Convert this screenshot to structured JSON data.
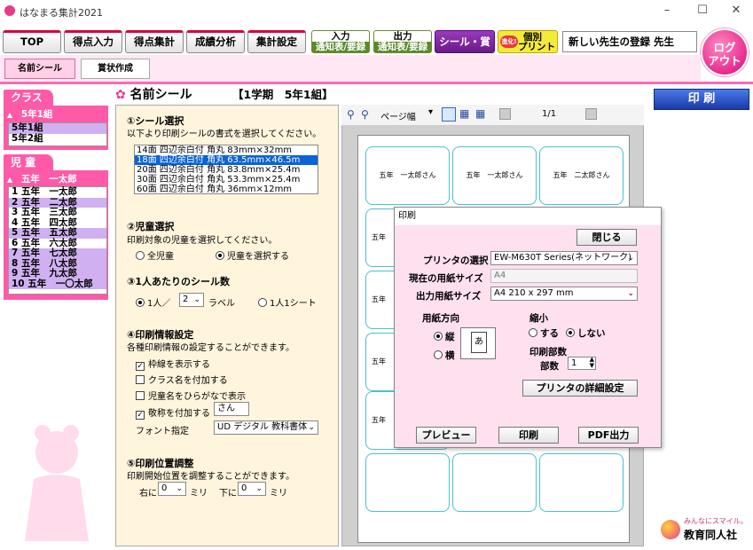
{
  "window": {
    "title": "はなまる集計2021"
  },
  "menu": {
    "top": "TOP",
    "score_input": "得点入力",
    "score_total": "得点集計",
    "analysis": "成績分析",
    "settings": "集計設定",
    "input_top": "入力",
    "input_bottom": "通知表/要録",
    "output_top": "出力",
    "output_bottom": "通知表/要録",
    "seal": "シール・賞状",
    "print_badge": "進化!",
    "print_top": "個別",
    "print_bottom": "プリント",
    "teacher": "新しい先生の登録 先生",
    "logout_1": "ログ",
    "logout_2": "アウト"
  },
  "subtabs": {
    "name_seal": "名前シール",
    "certificate": "賞状作成"
  },
  "class_panel": {
    "header": "クラス",
    "selected": "5年1組",
    "items": [
      "5年1組",
      "5年2組"
    ]
  },
  "student_panel": {
    "header": "児 童",
    "selected": "五年　一太郎",
    "items": [
      "1 五年　一太郎",
      "2 五年　二太郎",
      "3 五年　三太郎",
      "4 五年　四太郎",
      "5 五年　五太郎",
      "6 五年　六太郎",
      "7 五年　七太郎",
      "8 五年　八太郎",
      "9 五年　九太郎",
      "10 五年　一〇太郎"
    ]
  },
  "page": {
    "title": "名前シール",
    "term": "【1学期　5年1組】"
  },
  "seal_select": {
    "heading": "①シール選択",
    "desc": "以下より印刷シールの書式を選択してください。",
    "formats": [
      "14面 四辺余白付 角丸 83mm×32mm",
      "18面 四辺余白付 角丸 63.5mm×46.5m",
      "20面 四辺余白付 角丸 83.8mm×25.4m",
      "30面 四辺余白付 角丸 53.3mm×25.4m",
      "60面 四辺余白付 角丸 36mm×12mm"
    ]
  },
  "student_select": {
    "heading": "②児童選択",
    "desc": "印刷対象の児童を選択してください。",
    "all": "全児童",
    "choose": "児童を選択する"
  },
  "per_person": {
    "heading": "③1人あたりのシール数",
    "one_per": "1人／",
    "count": "2",
    "label": "ラベル",
    "one_sheet": "1人1シート"
  },
  "print_info": {
    "heading": "④印刷情報設定",
    "desc": "各種印刷情報の設定することができます。",
    "border": "枠線を表示する",
    "class_name": "クラス名を付加する",
    "hiragana": "児童名をひらがなで表示",
    "honorific": "敬称を付加する",
    "honorific_value": "さん",
    "font_label": "フォント指定",
    "font_value": "UD デジタル 教科書体"
  },
  "position": {
    "heading": "⑤印刷位置調整",
    "desc": "印刷開始位置を調整することができます。",
    "right": "右に",
    "right_val": "0",
    "down": "下に",
    "down_val": "0",
    "unit": "ミリ"
  },
  "preview": {
    "zoom": "ページ幅",
    "pages": "1/1",
    "labels": [
      "五年　一太郎さん",
      "五年　一太郎さん",
      "五年　二太郎さん"
    ],
    "side_label": "五年"
  },
  "print_button": "印 刷",
  "dialog": {
    "title": "印刷",
    "close": "閉じる",
    "printer_label": "プリンタの選択",
    "printer_value": "EW-M630T Series(ネットワーク)",
    "current_paper_label": "現在の用紙サイズ",
    "current_paper_value": "A4",
    "output_paper_label": "出力用紙サイズ",
    "output_paper_value": "A4 210 x 297 mm",
    "orientation": "用紙方向",
    "portrait": "縦",
    "landscape": "横",
    "glyph": "あ",
    "shrink": "縮小",
    "shrink_yes": "する",
    "shrink_no": "しない",
    "copies_label": "印刷部数",
    "copies_unit": "部数",
    "copies_value": "1",
    "printer_detail": "プリンタの詳細設定",
    "preview": "プレビュー",
    "print": "印刷",
    "pdf": "PDF出力"
  },
  "logo": {
    "tagline": "みんなにスマイル。",
    "name": "教育同人社"
  }
}
